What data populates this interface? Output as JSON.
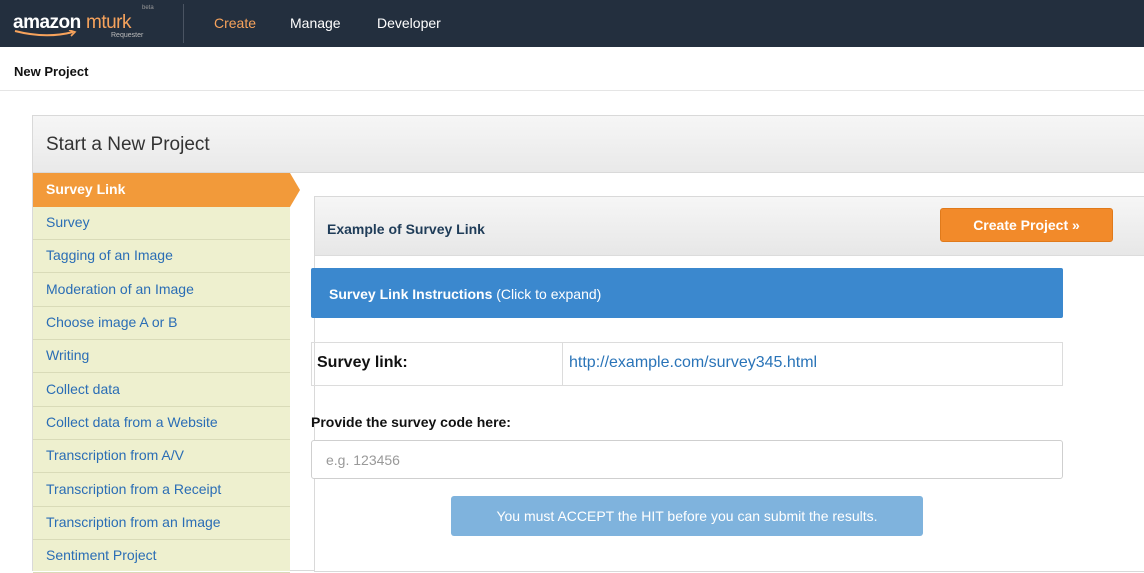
{
  "nav": {
    "logo_amazon": "amazon",
    "logo_mturk": "mturk",
    "logo_beta": "beta",
    "logo_requester": "Requester",
    "links": [
      "Create",
      "Manage",
      "Developer"
    ]
  },
  "page": {
    "heading": "New Project"
  },
  "panel": {
    "title": "Start a New Project",
    "sidebar": [
      "Survey Link",
      "Survey",
      "Tagging of an Image",
      "Moderation of an Image",
      "Choose image A or B",
      "Writing",
      "Collect data",
      "Collect data from a Website",
      "Transcription from A/V",
      "Transcription from a Receipt",
      "Transcription from an Image",
      "Sentiment Project"
    ],
    "active_index": 0
  },
  "example": {
    "title": "Example of Survey Link",
    "create_button": "Create Project »",
    "instructions_bold": "Survey Link Instructions",
    "instructions_rest": " (Click to expand)",
    "survey_link_label": "Survey link:",
    "survey_link_value": "http://example.com/survey345.html",
    "code_label": "Provide the survey code here:",
    "code_placeholder": "e.g. 123456",
    "code_value": "",
    "submit_text": "You must ACCEPT the HIT before you can submit the results."
  },
  "colors": {
    "nav_bg": "#232f3e",
    "accent_orange": "#f29a3a",
    "instructions_blue": "#3b88ce",
    "sidebar_bg": "#eef0cf",
    "link_blue": "#2a74b8"
  }
}
